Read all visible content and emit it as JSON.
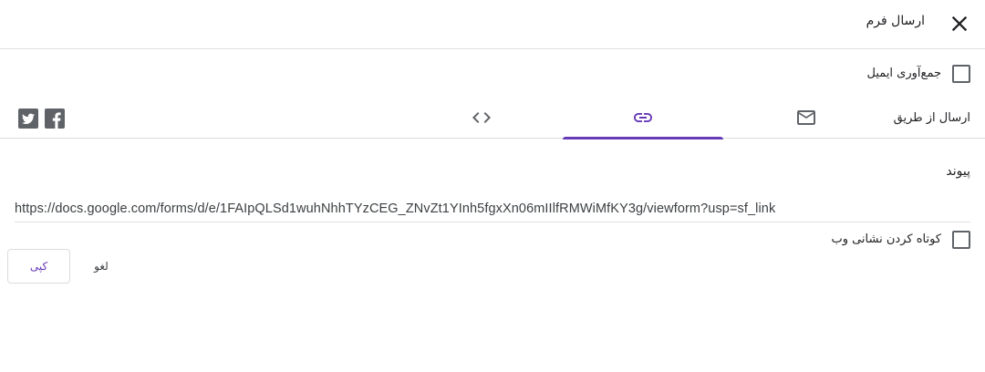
{
  "header": {
    "title": "ارسال فرم",
    "close_icon": "close-icon"
  },
  "collect_emails": {
    "label": "جمع‌آوری ایمیل",
    "checked": false
  },
  "send_via": {
    "label": "ارسال از طریق",
    "tabs": [
      {
        "icon": "email-icon",
        "selected": false
      },
      {
        "icon": "link-icon",
        "selected": true
      },
      {
        "icon": "embed-code-icon",
        "selected": false
      }
    ],
    "social": [
      {
        "icon": "facebook-icon"
      },
      {
        "icon": "twitter-icon"
      }
    ]
  },
  "link": {
    "label": "پیوند",
    "url": "https://docs.google.com/forms/d/e/1FAIpQLSd1wuhNhhTYzCEG_ZNvZt1YInh5fgxXn06mIIlfRMWiMfKY3g/viewform?usp=sf_link"
  },
  "shorten_url": {
    "label": "کوتاه کردن نشانی وب",
    "checked": false
  },
  "actions": {
    "copy_label": "کپی",
    "cancel_label": "لغو"
  },
  "colors": {
    "accent": "#673ab7",
    "icon_gray": "#5f6368",
    "divider": "#e0e0e0"
  }
}
